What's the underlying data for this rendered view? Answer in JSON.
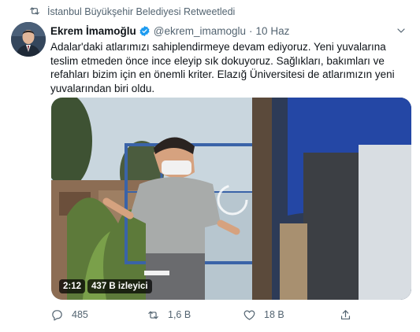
{
  "retweet_context": {
    "label": "İstanbul Büyükşehir Belediyesi Retweetledi",
    "icon": "retweet-icon"
  },
  "author": {
    "name": "Ekrem İmamoğlu",
    "handle": "@ekrem_imamoglu",
    "separator": "·",
    "date": "10 Haz",
    "verified": true
  },
  "tweet": {
    "text": "Adalar'daki atlarımızı sahiplendirmeye devam ediyoruz. Yeni yuvalarına teslim etmeden önce ince eleyip sık dokuyoruz. Sağlıkları, bakımları ve refahları bizim için en önemli kriter. Elazığ Üniversitesi de atlarımızın yeni yuvalarından biri oldu."
  },
  "media": {
    "duration": "2:12",
    "views": "437 B izleyici"
  },
  "actions": {
    "reply_count": "485",
    "retweet_count": "1,6 B",
    "like_count": "18 B"
  },
  "colors": {
    "text": "#0f1419",
    "secondary": "#536471",
    "verified": "#1d9bf0"
  }
}
